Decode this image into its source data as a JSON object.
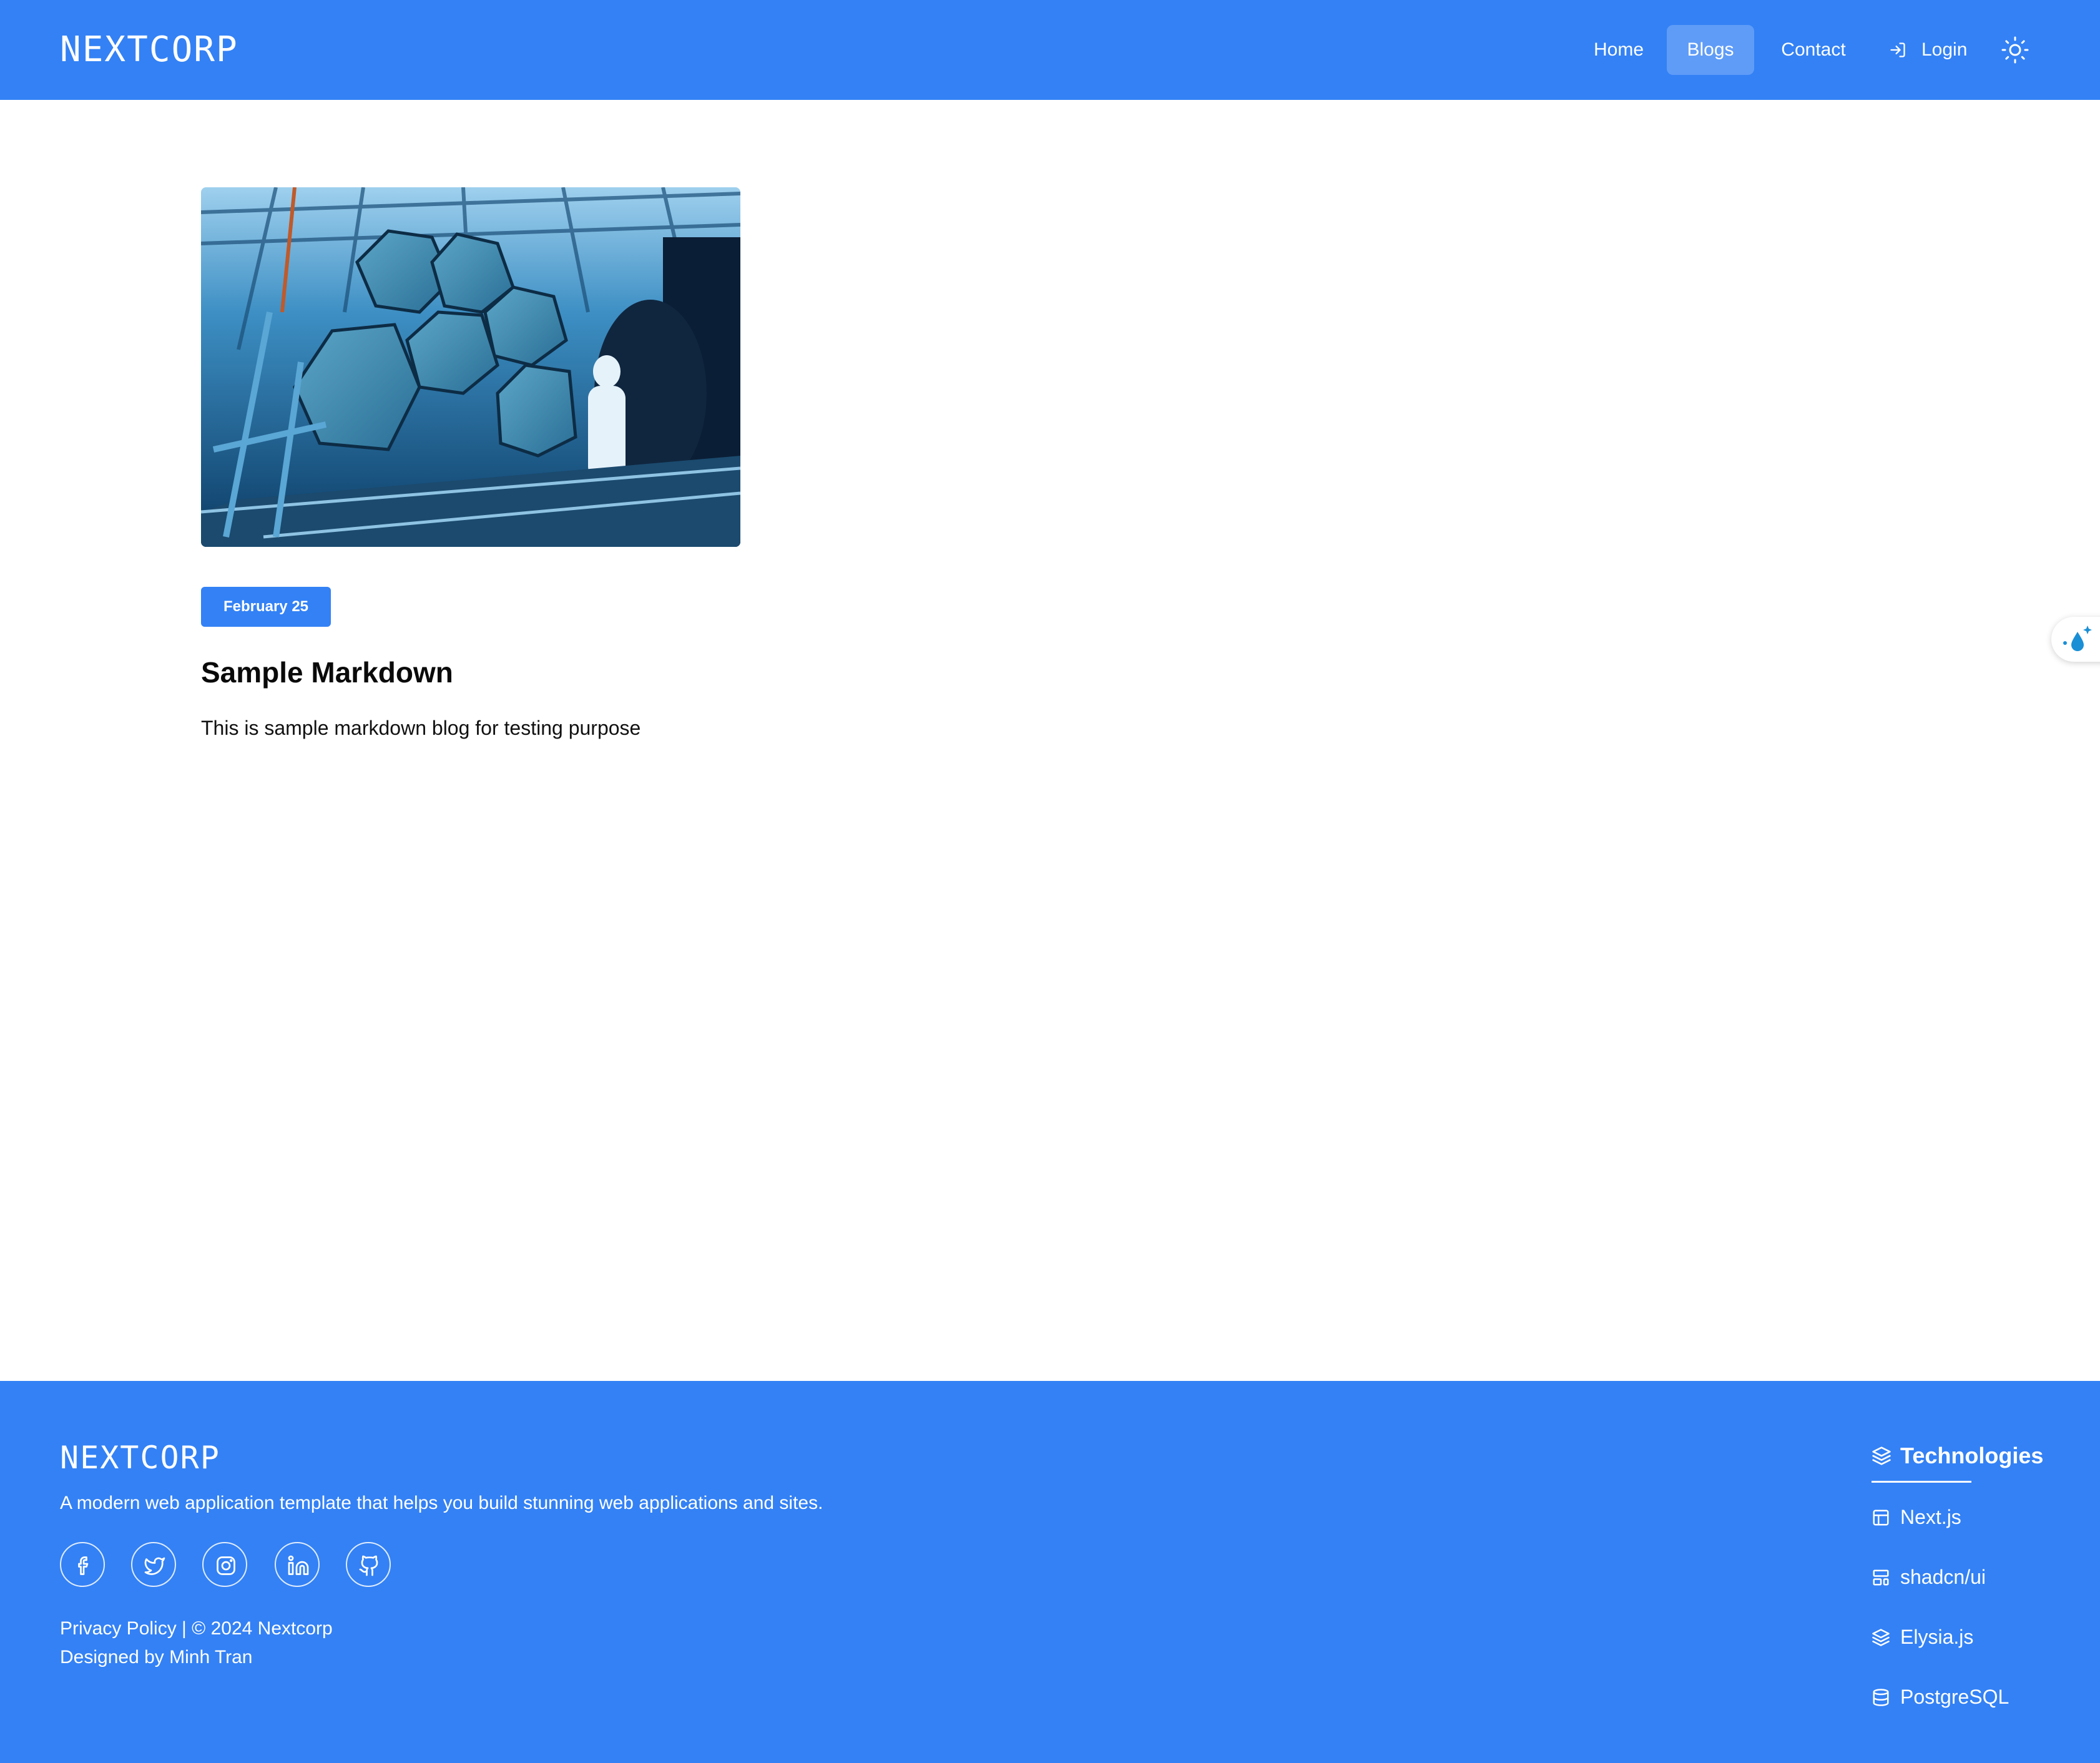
{
  "header": {
    "logo": "NEXTCORP",
    "nav": {
      "home": "Home",
      "blogs": "Blogs",
      "contact": "Contact",
      "login": "Login"
    },
    "active_nav": "Blogs",
    "theme_icon": "sun-icon"
  },
  "blog": {
    "posts": [
      {
        "date": "February 25",
        "title": "Sample Markdown",
        "description": "This is sample markdown blog for testing purpose",
        "image": "telescope-mirror-segments-photo"
      }
    ]
  },
  "footer": {
    "logo": "NEXTCORP",
    "tagline": "A modern web application template that helps you build stunning web applications and sites.",
    "social_icons": [
      "facebook-icon",
      "twitter-icon",
      "instagram-icon",
      "linkedin-icon",
      "github-icon"
    ],
    "copyright": "Privacy Policy | © 2024 Nextcorp",
    "credit": "Designed by Minh Tran",
    "technologies": {
      "heading": "Technologies",
      "items": [
        "Next.js",
        "shadcn/ui",
        "Elysia.js",
        "PostgreSQL"
      ]
    }
  },
  "colors": {
    "brand": "#3381f5",
    "text_on_brand": "#ffffff"
  }
}
